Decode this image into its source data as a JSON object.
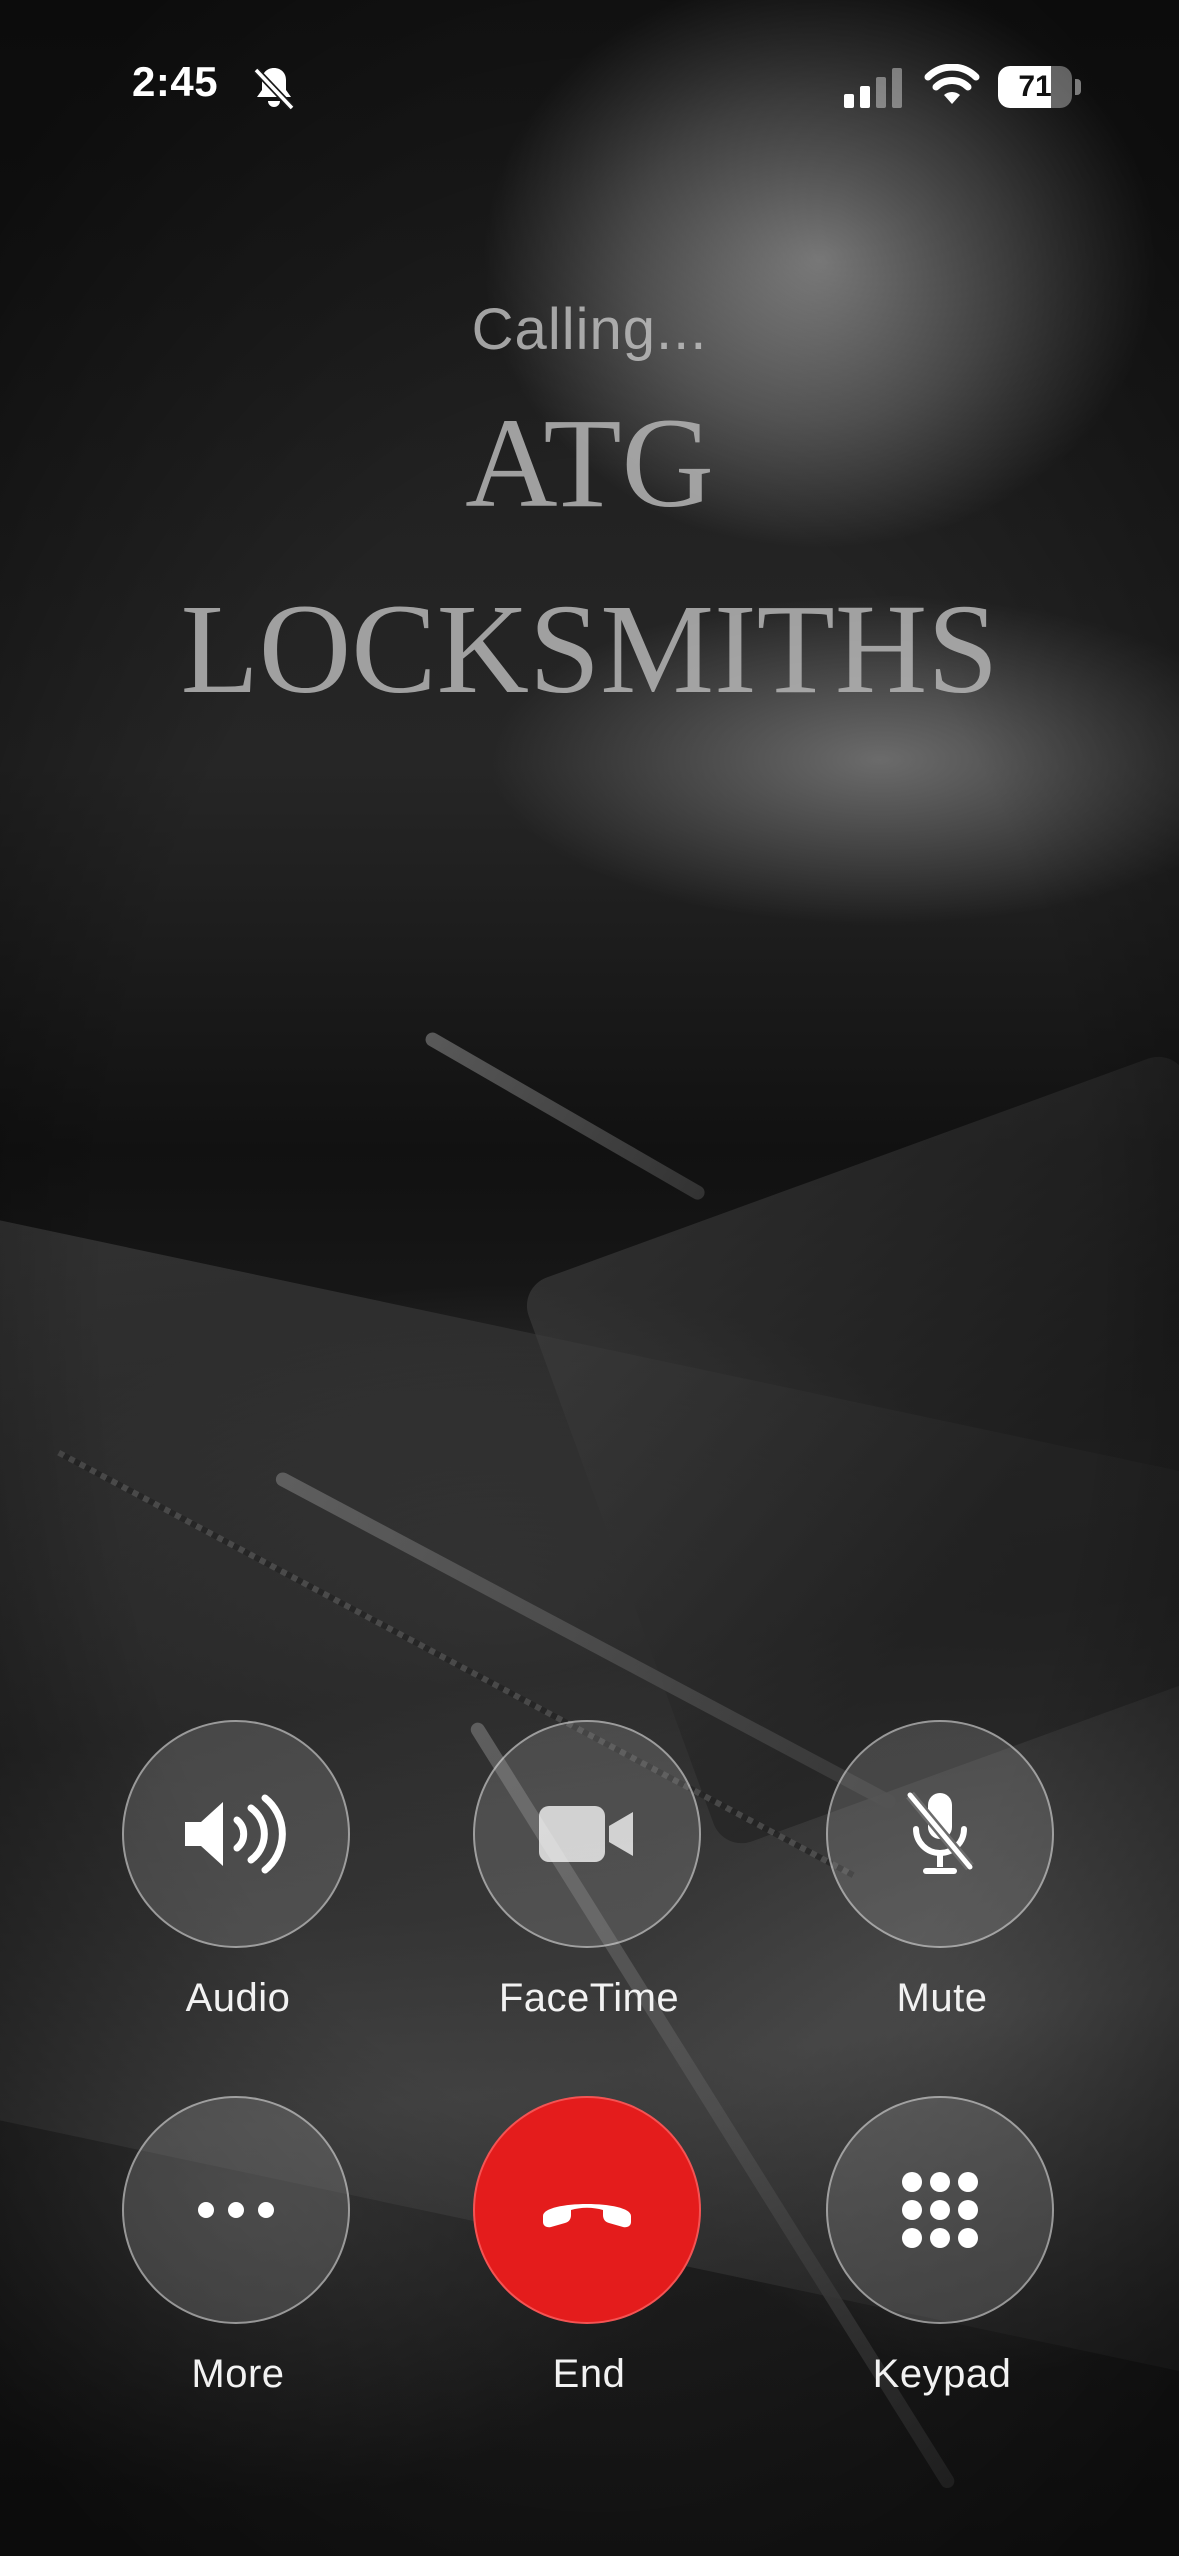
{
  "status_bar": {
    "time": "2:45",
    "battery_level": "71",
    "icons": [
      "bell-slash-icon",
      "cellular-signal-icon",
      "wifi-icon",
      "battery-icon"
    ]
  },
  "call": {
    "status": "Calling...",
    "caller_name_line1": "ATG",
    "caller_name_line2": "LOCKSMITHS"
  },
  "controls": [
    {
      "label": "Audio",
      "icon": "speaker-icon"
    },
    {
      "label": "FaceTime",
      "icon": "video-camera-icon"
    },
    {
      "label": "Mute",
      "icon": "microphone-slash-icon"
    },
    {
      "label": "More",
      "icon": "ellipsis-icon"
    },
    {
      "label": "End",
      "icon": "phone-hangup-icon",
      "color": "#e41c1c"
    },
    {
      "label": "Keypad",
      "icon": "keypad-icon"
    }
  ]
}
